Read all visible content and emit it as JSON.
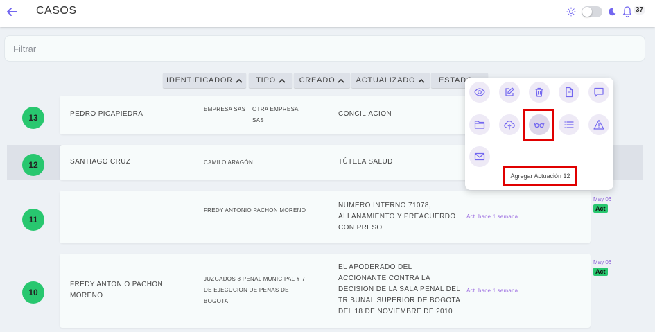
{
  "header": {
    "title": "CASOS",
    "notification_count": "37"
  },
  "filter": {
    "placeholder": "Filtrar",
    "value": ""
  },
  "sort_buttons": [
    "IDENTIFICADOR",
    "TIPO",
    "CREADO",
    "ACTUALIZADO",
    "ESTADO"
  ],
  "cases": [
    {
      "id": "13",
      "name": "PEDRO PICAPIEDRA",
      "parties": [
        "EMPRESA SAS",
        "OTRA EMPRESA SAS"
      ],
      "type": "CONCILIACIÓN",
      "activity": "",
      "date": "",
      "status": ""
    },
    {
      "id": "12",
      "name": "SANTIAGO CRUZ",
      "parties": [
        "CAMILO ARAGÓN"
      ],
      "type": "TÚTELA SALUD",
      "activity": "",
      "date": "",
      "status": ""
    },
    {
      "id": "11",
      "name": "",
      "parties": [
        "FREDY ANTONIO PACHON MORENO"
      ],
      "type": "NUMERO INTERNO 71078, ALLANAMIENTO Y PREACUERDO CON PRESO",
      "activity": "Act. hace 1 semana",
      "date": "May 06",
      "status": "Act"
    },
    {
      "id": "10",
      "name": "FREDY ANTONIO PACHON MORENO",
      "parties": [
        "JUZGADOS 8 PENAL MUNICIPAL Y 7 DE EJECUCION DE PENAS DE BOGOTA"
      ],
      "type": "EL APODERADO DEL ACCIONANTE CONTRA LA DECISION DE LA SALA PENAL DEL TRIBUNAL SUPERIOR DE BOGOTA DEL 18 DE NOVIEMBRE DE 2010",
      "activity": "Act. hace 1 semana",
      "date": "May 06",
      "status": "Act"
    }
  ],
  "actions_popup": {
    "icons": [
      "eye-icon",
      "edit-icon",
      "trash-icon",
      "document-icon",
      "chat-icon",
      "folder-icon",
      "cloud-upload-icon",
      "glasses-icon",
      "list-icon",
      "warning-icon",
      "mail-icon"
    ],
    "tooltip": "Agregar Actuación 12"
  },
  "colors": {
    "accent": "#7367f0",
    "badge_green": "#28c76f",
    "highlight_red": "#e00000",
    "purple_text": "#9b6be0"
  }
}
